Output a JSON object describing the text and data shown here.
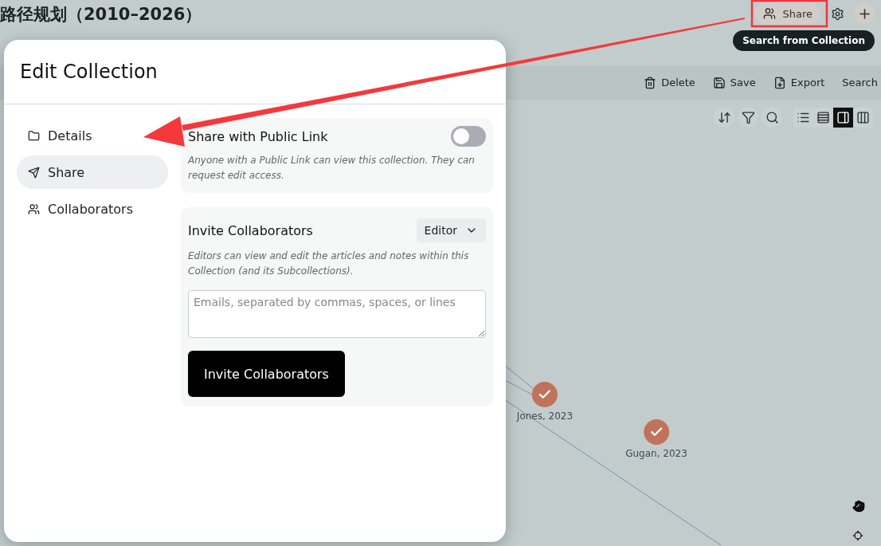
{
  "page": {
    "title": "路径规划（2010–2026）",
    "share_button": "Share",
    "tooltip": "Search from Collection",
    "toolbar": [
      {
        "kind": "delete",
        "label": "Delete"
      },
      {
        "kind": "save",
        "label": "Save"
      },
      {
        "kind": "export",
        "label": "Export"
      },
      {
        "kind": "search",
        "label": "Search"
      }
    ],
    "view_modes": [
      {
        "kind": "list",
        "selected": false
      },
      {
        "kind": "table",
        "selected": false
      },
      {
        "kind": "compact",
        "selected": true
      },
      {
        "kind": "columns",
        "selected": false
      }
    ],
    "graph_nodes": [
      {
        "label": "Jones, 2023",
        "checked": true
      },
      {
        "label": "Gugan, 2023",
        "checked": true
      }
    ]
  },
  "modal": {
    "title": "Edit Collection",
    "nav": [
      {
        "kind": "folder",
        "label": "Details",
        "selected": false
      },
      {
        "kind": "send",
        "label": "Share",
        "selected": true
      },
      {
        "kind": "users",
        "label": "Collaborators",
        "selected": false
      }
    ],
    "public_link": {
      "title": "Share with Public Link",
      "on": false,
      "description": "Anyone with a Public Link can view this collection. They can request edit access."
    },
    "invite": {
      "title": "Invite Collaborators",
      "role": "Editor",
      "description": "Editors can view and edit the articles and notes within this Collection (and its Subcollections).",
      "placeholder": "Emails, separated by commas, spaces, or lines",
      "button": "Invite Collaborators"
    }
  }
}
